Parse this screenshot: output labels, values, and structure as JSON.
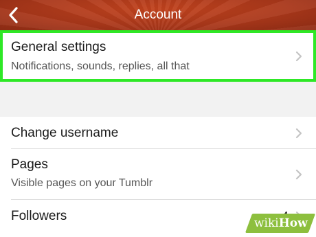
{
  "header": {
    "title": "Account",
    "back_icon": "chevron-left-icon"
  },
  "group1": {
    "general_settings": {
      "title": "General settings",
      "subtitle": "Notifications, sounds, replies, all that"
    }
  },
  "group2": {
    "change_username": {
      "title": "Change username"
    },
    "pages": {
      "title": "Pages",
      "subtitle": "Visible pages on your Tumblr"
    },
    "followers": {
      "title": "Followers",
      "count": "4"
    }
  },
  "icons": {
    "row_chevron": "chevron-right-icon"
  },
  "colors": {
    "header_bg": "#a9371a",
    "highlight_border": "#2ee826",
    "page_bg": "#f2f2f2",
    "watermark_bg": "#8dbf3e"
  },
  "watermark": {
    "wiki": "wiki",
    "how": "How"
  }
}
